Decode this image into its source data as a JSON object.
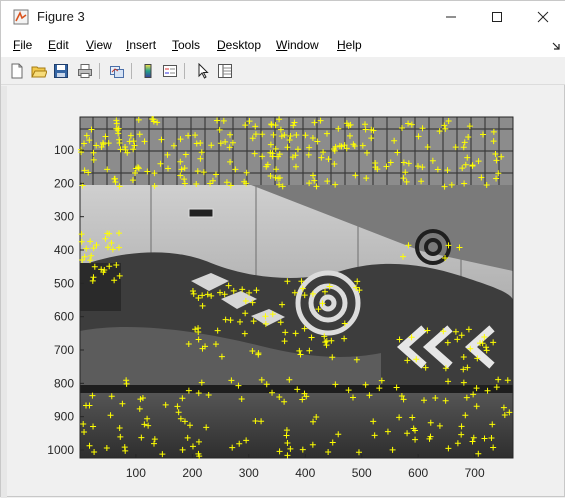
{
  "window": {
    "title": "Figure 3",
    "controls": [
      "minimize",
      "maximize",
      "close"
    ]
  },
  "menubar": {
    "items": [
      {
        "label": "File",
        "mnemonic": "F"
      },
      {
        "label": "Edit",
        "mnemonic": "E"
      },
      {
        "label": "View",
        "mnemonic": "V"
      },
      {
        "label": "Insert",
        "mnemonic": "I"
      },
      {
        "label": "Tools",
        "mnemonic": "T"
      },
      {
        "label": "Desktop",
        "mnemonic": "D"
      },
      {
        "label": "Window",
        "mnemonic": "W"
      },
      {
        "label": "Help",
        "mnemonic": "H"
      }
    ]
  },
  "toolbar": {
    "buttons": [
      "new-figure-icon",
      "open-file-icon",
      "save-icon",
      "print-icon",
      "link-plot-icon",
      "colorbar-icon",
      "legend-icon",
      "edit-plot-arrow-icon",
      "property-inspector-icon"
    ]
  },
  "axes": {
    "xticks": [
      "100",
      "200",
      "300",
      "400",
      "500",
      "600",
      "700"
    ],
    "yticks": [
      "100",
      "200",
      "300",
      "400",
      "500",
      "600",
      "700",
      "800",
      "900",
      "1000"
    ],
    "xlim": [
      1,
      768
    ],
    "ylim": [
      1,
      1024
    ],
    "marker_color": "#ffff00",
    "image_description_palette": [
      "#3a3a3a",
      "#8a8a8a",
      "#c8c8c8"
    ]
  },
  "colors": {
    "marker": "#ffff00",
    "menubar_bg": "#ffffff",
    "toolbar_bg": "#f0f0f0"
  }
}
